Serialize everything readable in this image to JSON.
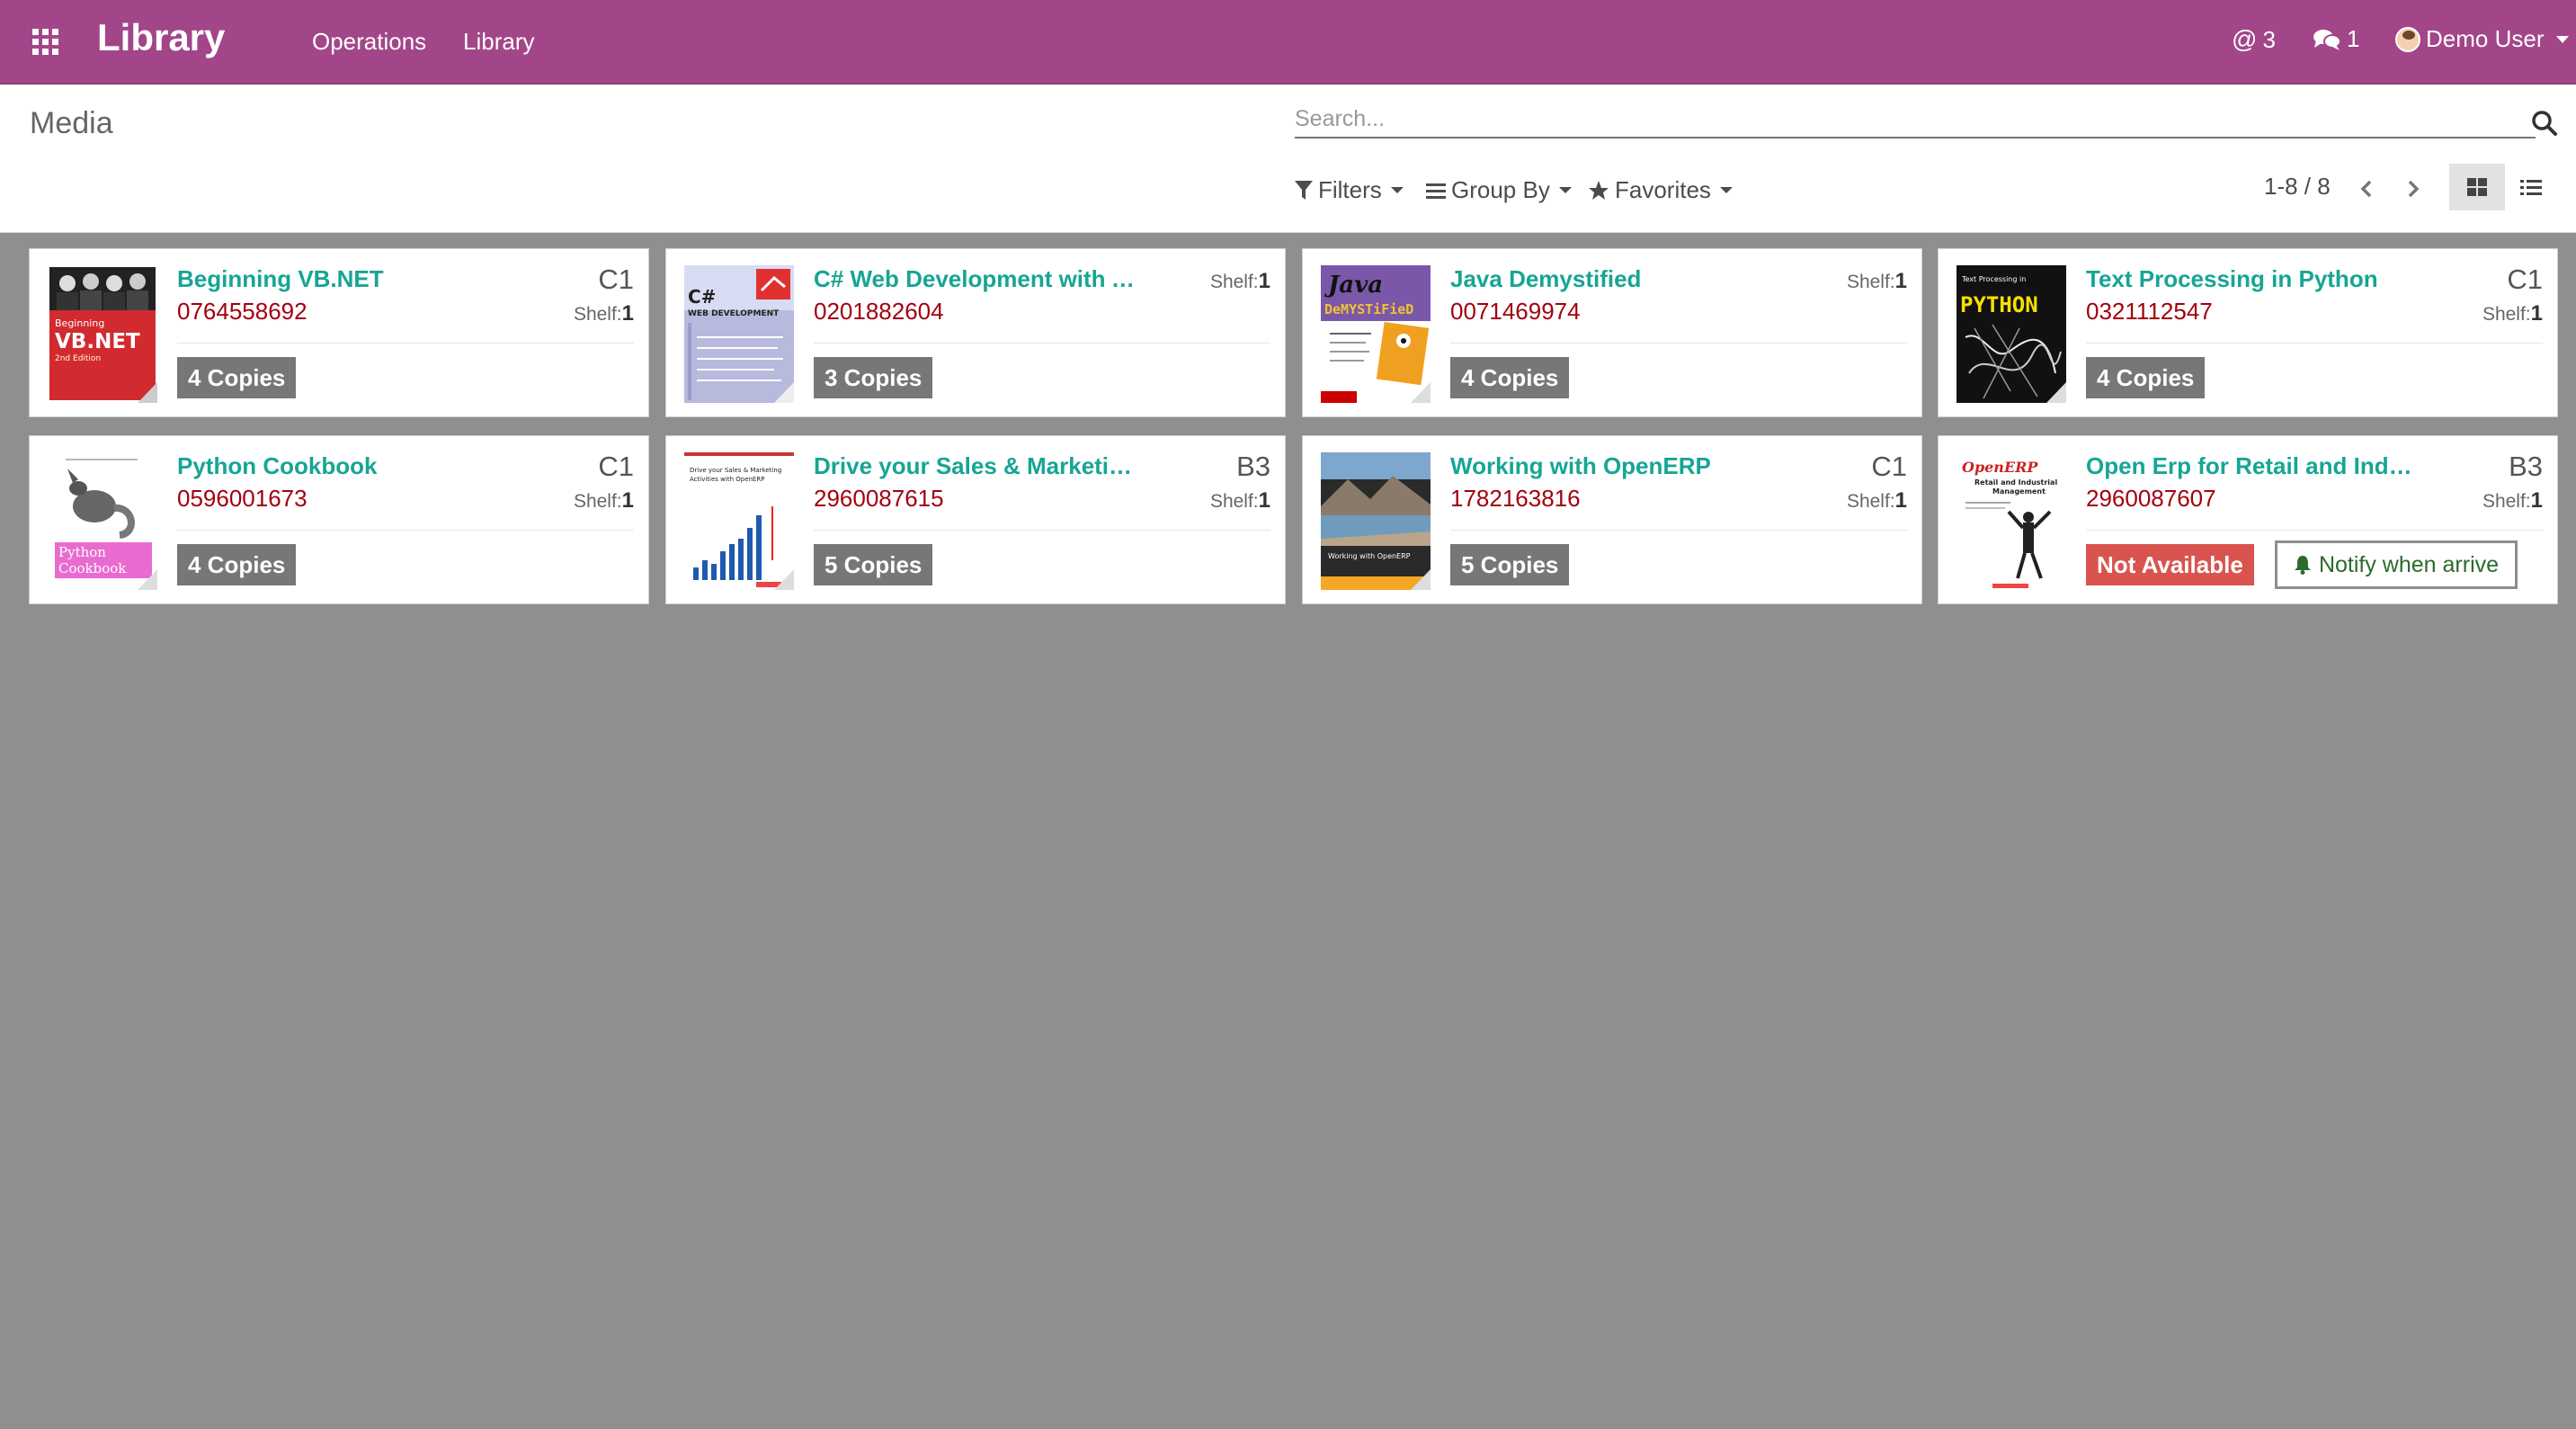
{
  "navbar": {
    "brand": "Library",
    "menu": [
      "Operations",
      "Library"
    ],
    "mentions_count": "3",
    "messages_count": "1",
    "user_name": "Demo User"
  },
  "control_panel": {
    "breadcrumb": "Media",
    "search_placeholder": "Search...",
    "filters_label": "Filters",
    "groupby_label": "Group By",
    "favorites_label": "Favorites",
    "pager": "1-8 / 8"
  },
  "colors": {
    "navbar": "#a24689",
    "title": "#17a594",
    "isbn": "#a3000e",
    "badge": "#777777",
    "not_available": "#d9534f",
    "background": "#8f8f8f"
  },
  "books": [
    {
      "title": "Beginning VB.NET",
      "isbn": "0764558692",
      "code": "C1",
      "shelf_label": "Shelf:",
      "shelf": "1",
      "copies": "4 Copies",
      "cover": "vbnet"
    },
    {
      "title": "C# Web Development with AS...",
      "isbn": "0201882604",
      "code": "",
      "shelf_label": "Shelf:",
      "shelf": "1",
      "copies": "3 Copies",
      "cover": "csharp"
    },
    {
      "title": "Java Demystified",
      "isbn": "0071469974",
      "code": "",
      "shelf_label": "Shelf:",
      "shelf": "1",
      "copies": "4 Copies",
      "cover": "java"
    },
    {
      "title": "Text Processing in Python",
      "isbn": "0321112547",
      "code": "C1",
      "shelf_label": "Shelf:",
      "shelf": "1",
      "copies": "4 Copies",
      "cover": "python-text"
    },
    {
      "title": "Python Cookbook",
      "isbn": "0596001673",
      "code": "C1",
      "shelf_label": "Shelf:",
      "shelf": "1",
      "copies": "4 Copies",
      "cover": "cookbook"
    },
    {
      "title": "Drive your Sales & Marketing ...",
      "isbn": "2960087615",
      "code": "B3",
      "shelf_label": "Shelf:",
      "shelf": "1",
      "copies": "5 Copies",
      "cover": "sales"
    },
    {
      "title": "Working with OpenERP",
      "isbn": "1782163816",
      "code": "C1",
      "shelf_label": "Shelf:",
      "shelf": "1",
      "copies": "5 Copies",
      "cover": "openerp"
    },
    {
      "title": "Open Erp for Retail and Indust...",
      "isbn": "2960087607",
      "code": "B3",
      "shelf_label": "Shelf:",
      "shelf": "1",
      "copies": "",
      "not_available": "Not Available",
      "notify": "Notify when arrive",
      "cover": "retail"
    }
  ],
  "cover_texts": {
    "vbnet_line1": "Beginning",
    "vbnet_line2": "VB.NET",
    "vbnet_line3": "2nd Edition",
    "csharp_line1": "C#",
    "csharp_line2": "WEB DEVELOPMENT",
    "java_line1": "Java",
    "java_line2": "DeMYSTiFieD",
    "python_text_line1": "Text Processing in",
    "python_text_line2": "PYTHON",
    "cookbook_line1": "Python",
    "cookbook_line2": "Cookbook",
    "sales_line1": "Drive your Sales & Marketing",
    "sales_line2": "Activities with OpenERP",
    "openerp_line1": "Working with OpenERP",
    "retail_line1": "OpenERP",
    "retail_line2": "Retail and Industrial",
    "retail_line3": "Management"
  }
}
